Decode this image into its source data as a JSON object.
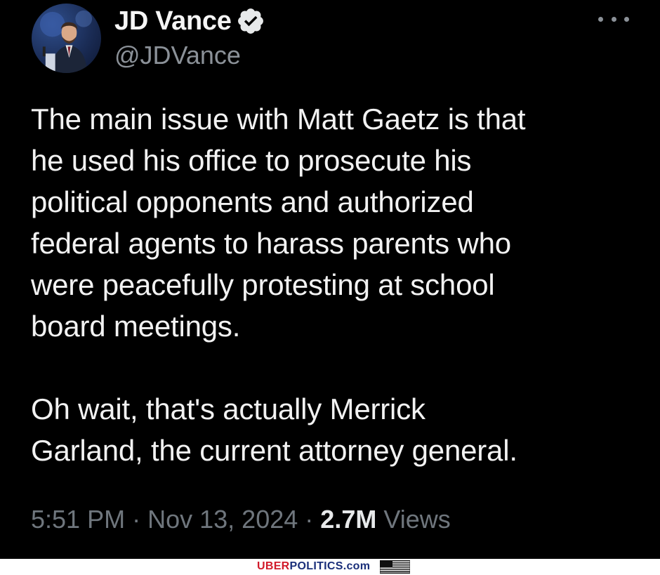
{
  "tweet": {
    "author": {
      "display_name": "JD Vance",
      "handle": "@JDVance",
      "verified": true,
      "avatar_icon": "profile-photo"
    },
    "more_icon": "more-horizontal-icon",
    "text": "The main issue with Matt Gaetz is that\nhe used his office to prosecute his\npolitical opponents and authorized\nfederal agents to harass parents who\nwere peacefully protesting at school\nboard meetings.\n\nOh wait, that's actually Merrick\nGarland, the current attorney general.",
    "time": "5:51 PM",
    "separator": "·",
    "date": "Nov 13, 2024",
    "views_count": "2.7M",
    "views_label": "Views"
  },
  "watermark": {
    "brand_part1": "UBER",
    "brand_part2": "POLITICS.com",
    "flag_icon": "us-flag-icon"
  },
  "colors": {
    "background": "#000000",
    "text_primary": "#e7e9ea",
    "text_secondary": "#8b9198",
    "verified_badge": "#e7e9ea",
    "brand_red": "#d11a2a",
    "brand_blue": "#1a2f7a"
  }
}
